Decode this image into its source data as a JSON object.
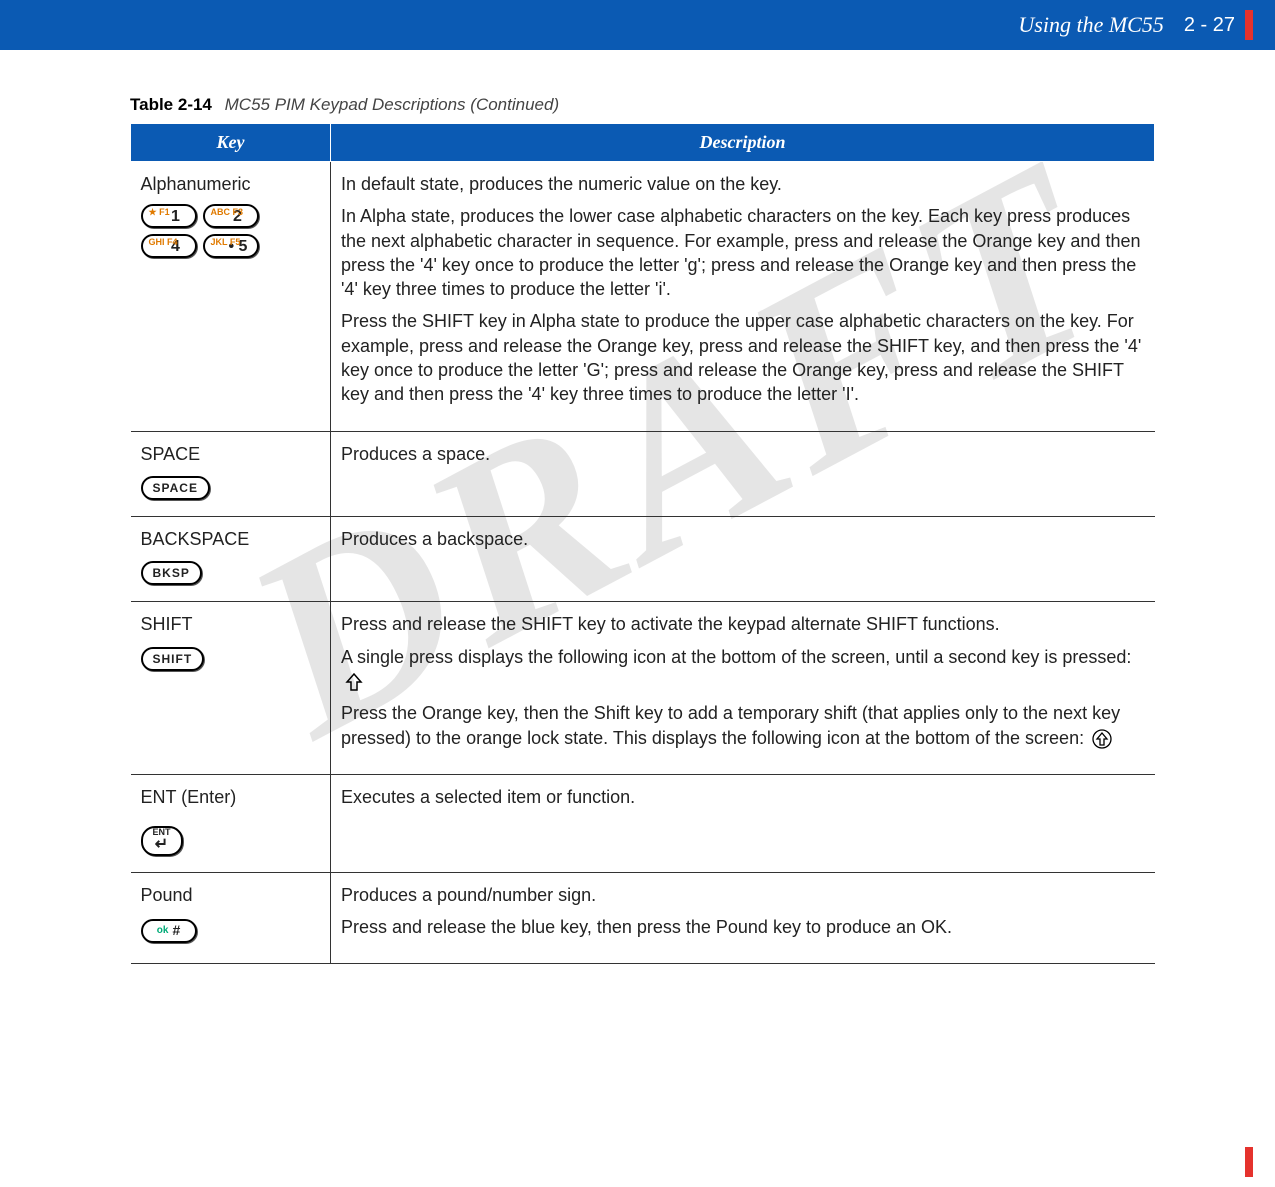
{
  "header": {
    "section": "Using the MC55",
    "page": "2 - 27"
  },
  "watermark": "DRAFT",
  "table": {
    "caption_label": "Table 2-14",
    "caption_title": "MC55 PIM Keypad Descriptions (Continued)",
    "head": {
      "key": "Key",
      "desc": "Description"
    },
    "rows": [
      {
        "key_label": "Alphanumeric",
        "key_icons": [
          {
            "small": "★\nF1",
            "big": "1"
          },
          {
            "small": "ABC\nF3",
            "big": "2"
          },
          {
            "small": "GHI\nF4",
            "big": "4"
          },
          {
            "small": "JKL\nF5",
            "big": "• 5"
          }
        ],
        "desc": [
          "In default state, produces the numeric value on the key.",
          "In Alpha state, produces the lower case alphabetic characters on the key. Each key press produces the next alphabetic character in sequence. For example, press and release the Orange key and then press the '4' key once to produce the letter 'g'; press and release the Orange key and then press the '4' key three times to produce the letter 'i'.",
          "Press the SHIFT key in Alpha state to produce the upper case alphabetic characters on the key. For example, press and release the Orange key, press and release the SHIFT key, and then press the '4' key once to produce the letter 'G'; press and release the Orange key, press and release the SHIFT key and then press the '4' key three times to produce the letter 'I'."
        ]
      },
      {
        "key_label": "SPACE",
        "key_pill": "SPACE",
        "desc": [
          "Produces a space."
        ]
      },
      {
        "key_label": "BACKSPACE",
        "key_pill": "BKSP",
        "desc": [
          "Produces a backspace."
        ]
      },
      {
        "key_label": "SHIFT",
        "key_pill": "SHIFT",
        "desc_parts": {
          "p1": "Press and release the SHIFT key to activate the keypad alternate SHIFT functions.",
          "p2a": "A single press displays the following icon at the bottom of the screen, until a second key is pressed:",
          "p3a": "Press the Orange key, then the Shift key to add a temporary shift (that applies only to the next key pressed) to the orange lock state. This displays the following icon at the bottom of the screen:"
        }
      },
      {
        "key_label": "ENT (Enter)",
        "key_pill_enter": {
          "top": "ENT",
          "arrow": "↵"
        },
        "desc": [
          "Executes a selected item or function."
        ]
      },
      {
        "key_label": "Pound",
        "key_pill_ok": {
          "ok": "ok",
          "hash": "#"
        },
        "desc": [
          "Produces a pound/number sign.",
          "Press and release the blue key, then press the Pound key to produce an OK."
        ]
      }
    ]
  }
}
